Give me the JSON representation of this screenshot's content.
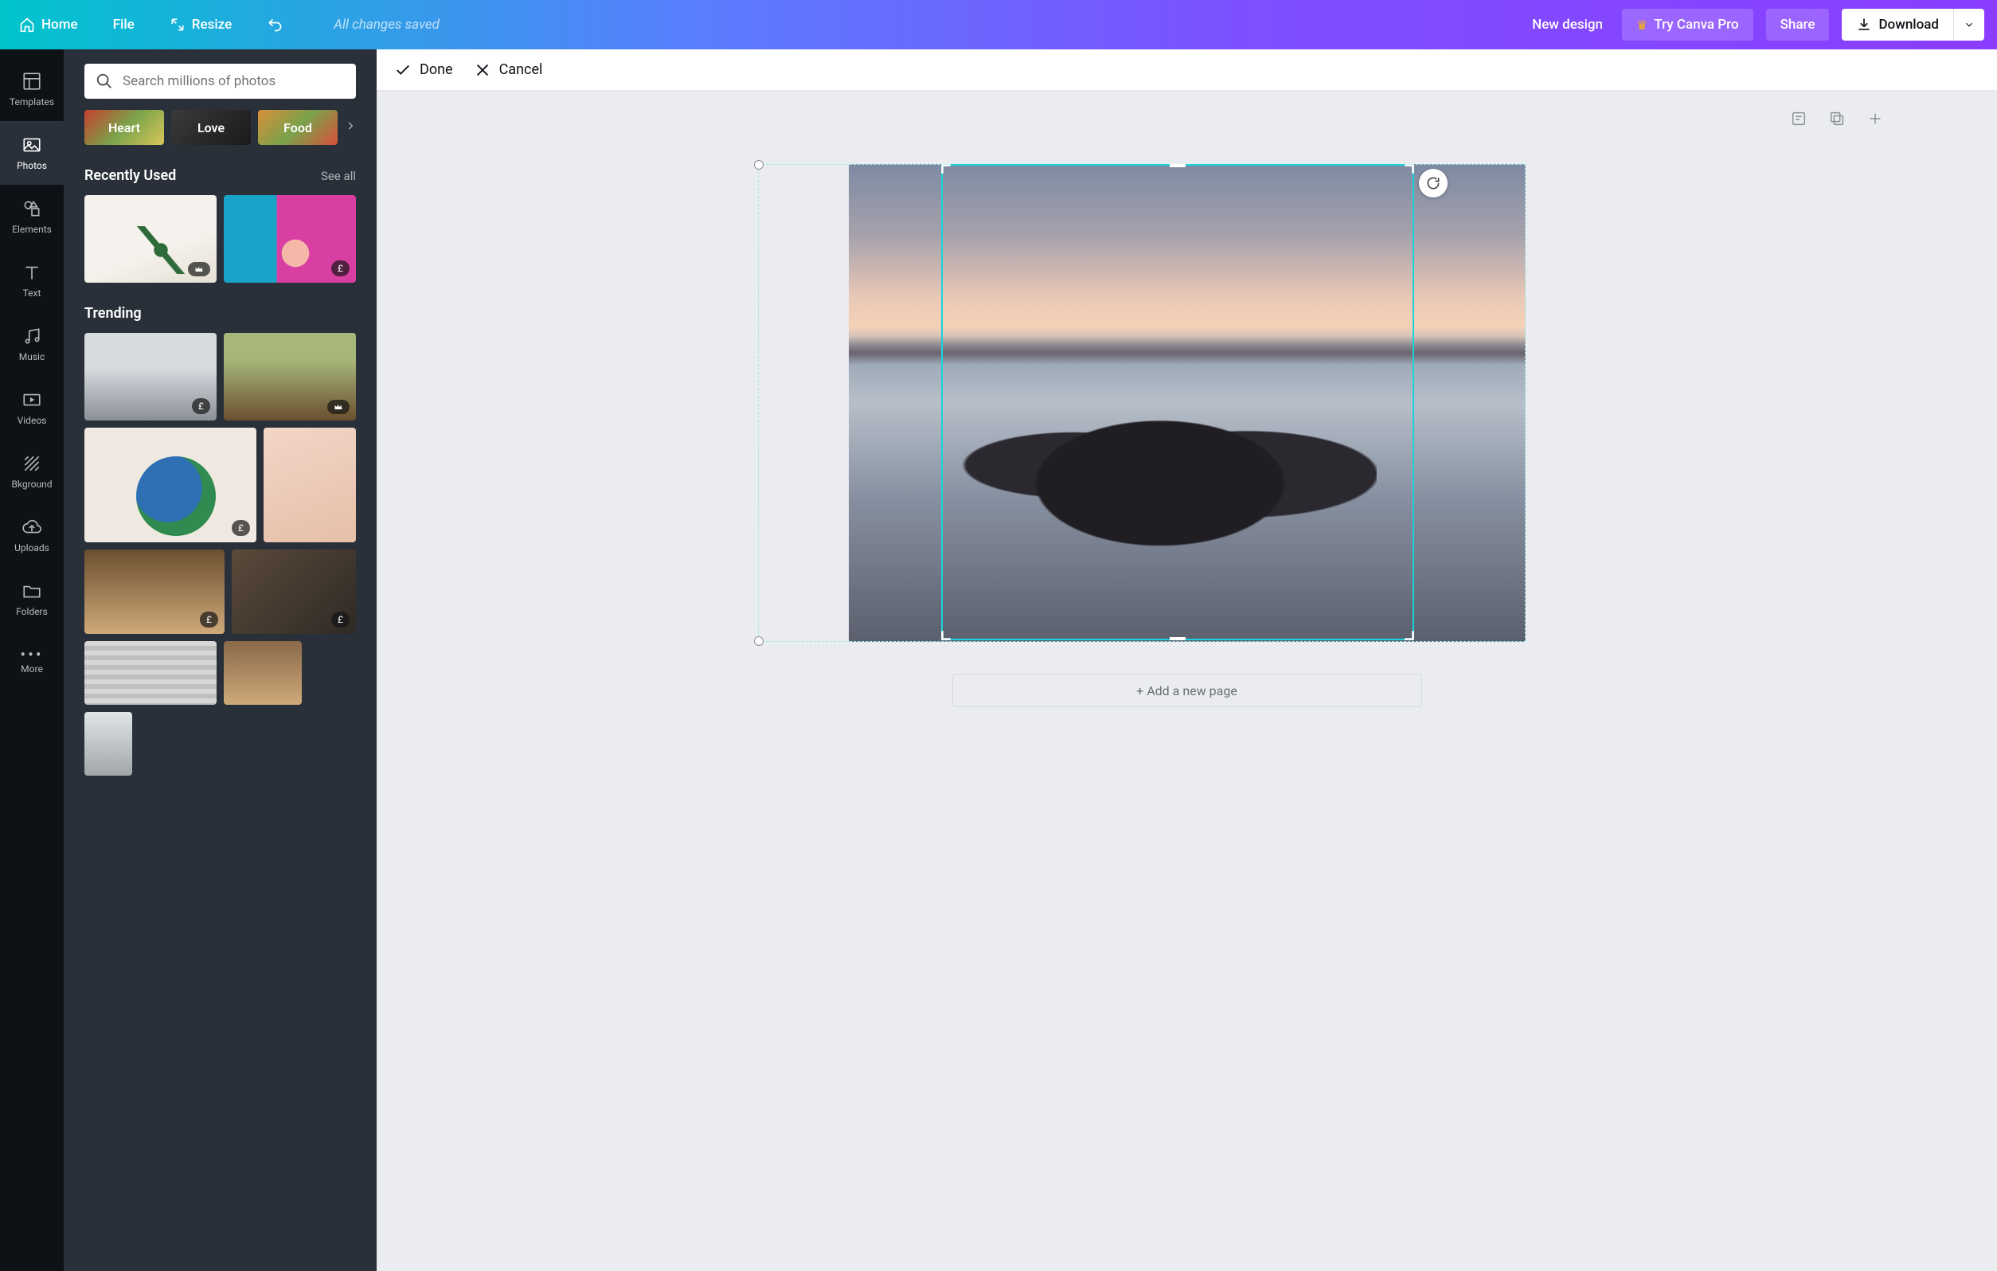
{
  "topbar": {
    "home": "Home",
    "file": "File",
    "resize": "Resize",
    "saved": "All changes saved",
    "new_design": "New design",
    "try_pro": "Try Canva Pro",
    "share": "Share",
    "download": "Download"
  },
  "vside": {
    "templates": "Templates",
    "photos": "Photos",
    "elements": "Elements",
    "text": "Text",
    "music": "Music",
    "videos": "Videos",
    "bkground": "Bkground",
    "uploads": "Uploads",
    "folders": "Folders",
    "more": "More"
  },
  "panel": {
    "search_placeholder": "Search millions of photos",
    "chips": {
      "heart": "Heart",
      "love": "Love",
      "food": "Food"
    },
    "recently_used": {
      "title": "Recently Used",
      "see_all": "See all"
    },
    "trending": {
      "title": "Trending"
    },
    "badges": {
      "pound": "£"
    }
  },
  "crop_toolbar": {
    "done": "Done",
    "cancel": "Cancel"
  },
  "canvas": {
    "add_page": "+ Add a new page"
  }
}
